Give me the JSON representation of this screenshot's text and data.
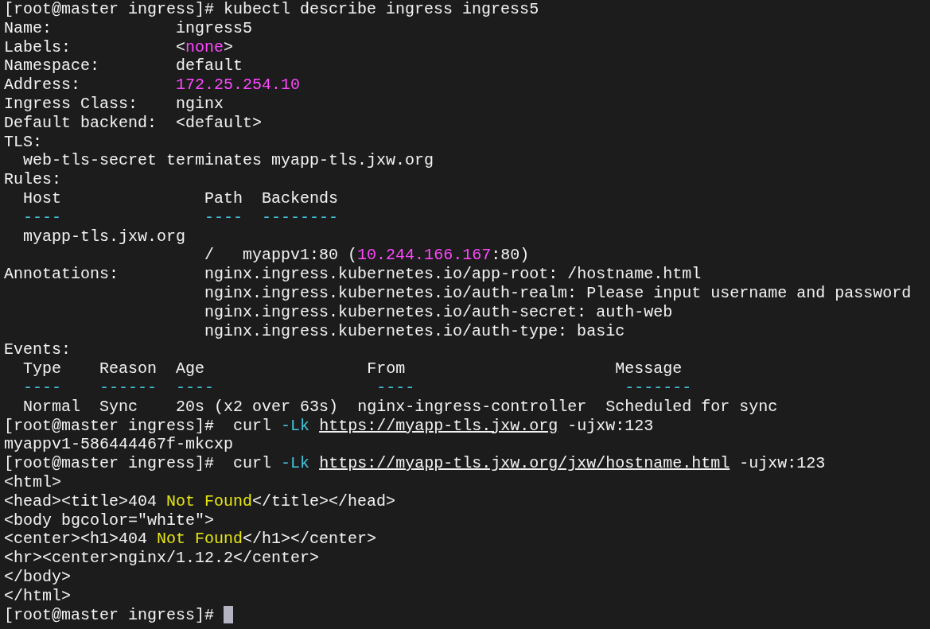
{
  "terminal": {
    "cursor_visible": true,
    "lines": [
      {
        "segments": [
          {
            "text": "[root@master ingress]#",
            "kind": "prompt"
          },
          {
            "text": " kubectl describe ingress ingress5",
            "kind": "command"
          }
        ]
      },
      {
        "segments": [
          {
            "text": "Name:",
            "kind": "label"
          },
          {
            "text": "             ingress5",
            "kind": "text"
          }
        ]
      },
      {
        "segments": [
          {
            "text": "Labels:",
            "kind": "label"
          },
          {
            "text": "           <",
            "kind": "text"
          },
          {
            "text": "none",
            "kind": "value"
          },
          {
            "text": ">",
            "kind": "text"
          }
        ]
      },
      {
        "segments": [
          {
            "text": "Namespace:",
            "kind": "label"
          },
          {
            "text": "        default",
            "kind": "text"
          }
        ]
      },
      {
        "segments": [
          {
            "text": "Address:",
            "kind": "label"
          },
          {
            "text": "          172.25.254.10",
            "kind": "value"
          }
        ]
      },
      {
        "segments": [
          {
            "text": "Ingress Class:",
            "kind": "label"
          },
          {
            "text": "    nginx",
            "kind": "text"
          }
        ]
      },
      {
        "segments": [
          {
            "text": "Default backend:",
            "kind": "label"
          },
          {
            "text": "  <default>",
            "kind": "text"
          }
        ]
      },
      {
        "segments": [
          {
            "text": "TLS:",
            "kind": "label"
          }
        ]
      },
      {
        "segments": [
          {
            "text": "  web-tls-secret terminates myapp-tls.jxw.org",
            "kind": "text"
          }
        ]
      },
      {
        "segments": [
          {
            "text": "Rules:",
            "kind": "label"
          }
        ]
      },
      {
        "segments": [
          {
            "text": "  Host",
            "kind": "header"
          },
          {
            "text": "               Path",
            "kind": "header"
          },
          {
            "text": "  Backends",
            "kind": "header"
          }
        ]
      },
      {
        "segments": [
          {
            "text": "  ----",
            "kind": "rule"
          },
          {
            "text": "               ----",
            "kind": "rule"
          },
          {
            "text": "  --------",
            "kind": "rule"
          }
        ]
      },
      {
        "segments": [
          {
            "text": "  myapp-tls.jxw.org",
            "kind": "text"
          }
        ]
      },
      {
        "segments": [
          {
            "text": "                     /",
            "kind": "text"
          },
          {
            "text": "   myappv1:80 (",
            "kind": "text"
          },
          {
            "text": "10.244.166.167",
            "kind": "value"
          },
          {
            "text": ":80)",
            "kind": "text"
          }
        ]
      },
      {
        "segments": [
          {
            "text": "Annotations:",
            "kind": "label"
          },
          {
            "text": "         nginx.ingress.kubernetes.io/app-root: /hostname.html",
            "kind": "text"
          }
        ]
      },
      {
        "segments": [
          {
            "text": "                     nginx.ingress.kubernetes.io/auth-realm: Please input username and password",
            "kind": "text"
          }
        ]
      },
      {
        "segments": [
          {
            "text": "                     nginx.ingress.kubernetes.io/auth-secret: auth-web",
            "kind": "text"
          }
        ]
      },
      {
        "segments": [
          {
            "text": "                     nginx.ingress.kubernetes.io/auth-type: basic",
            "kind": "text"
          }
        ]
      },
      {
        "segments": [
          {
            "text": "Events:",
            "kind": "label"
          }
        ]
      },
      {
        "segments": [
          {
            "text": "  Type",
            "kind": "header"
          },
          {
            "text": "    Reason",
            "kind": "header"
          },
          {
            "text": "  Age",
            "kind": "header"
          },
          {
            "text": "                 From",
            "kind": "header"
          },
          {
            "text": "                      Message",
            "kind": "header"
          }
        ]
      },
      {
        "segments": [
          {
            "text": "  ----",
            "kind": "rule"
          },
          {
            "text": "    ------",
            "kind": "rule"
          },
          {
            "text": "  ----",
            "kind": "rule"
          },
          {
            "text": "                 ----",
            "kind": "rule"
          },
          {
            "text": "                      -------",
            "kind": "rule"
          }
        ]
      },
      {
        "segments": [
          {
            "text": "  Normal",
            "kind": "text"
          },
          {
            "text": "  Sync",
            "kind": "text"
          },
          {
            "text": "    20s (x2 over 63s)",
            "kind": "text"
          },
          {
            "text": "  nginx-ingress-controller",
            "kind": "text"
          },
          {
            "text": "  Scheduled for sync",
            "kind": "text"
          }
        ]
      },
      {
        "segments": [
          {
            "text": "[root@master ingress]#",
            "kind": "prompt"
          },
          {
            "text": "  curl",
            "kind": "command"
          },
          {
            "text": " -Lk",
            "kind": "flag"
          },
          {
            "text": " https://myapp-tls.jxw.org",
            "kind": "link"
          },
          {
            "text": " -ujxw:123",
            "kind": "command"
          }
        ]
      },
      {
        "segments": [
          {
            "text": "myappv1-586444467f-mkcxp",
            "kind": "text"
          }
        ]
      },
      {
        "segments": [
          {
            "text": "[root@master ingress]#",
            "kind": "prompt"
          },
          {
            "text": "  curl",
            "kind": "command"
          },
          {
            "text": " -Lk",
            "kind": "flag"
          },
          {
            "text": " https://myapp-tls.jxw.org/jxw/hostname.html",
            "kind": "link"
          },
          {
            "text": " -ujxw:123",
            "kind": "command"
          }
        ]
      },
      {
        "segments": [
          {
            "text": "<html>",
            "kind": "text"
          }
        ]
      },
      {
        "segments": [
          {
            "text": "<head><title>404 ",
            "kind": "text"
          },
          {
            "text": "Not Found",
            "kind": "warn"
          },
          {
            "text": "</title></head>",
            "kind": "text"
          }
        ]
      },
      {
        "segments": [
          {
            "text": "<body bgcolor=\"white\">",
            "kind": "text"
          }
        ]
      },
      {
        "segments": [
          {
            "text": "<center><h1>404 ",
            "kind": "text"
          },
          {
            "text": "Not Found",
            "kind": "warn"
          },
          {
            "text": "</h1></center>",
            "kind": "text"
          }
        ]
      },
      {
        "segments": [
          {
            "text": "<hr><center>nginx/1.12.2</center>",
            "kind": "text"
          }
        ]
      },
      {
        "segments": [
          {
            "text": "</body>",
            "kind": "text"
          }
        ]
      },
      {
        "segments": [
          {
            "text": "</html>",
            "kind": "text"
          }
        ]
      },
      {
        "segments": [
          {
            "text": "[root@master ingress]#",
            "kind": "prompt"
          }
        ]
      }
    ]
  }
}
